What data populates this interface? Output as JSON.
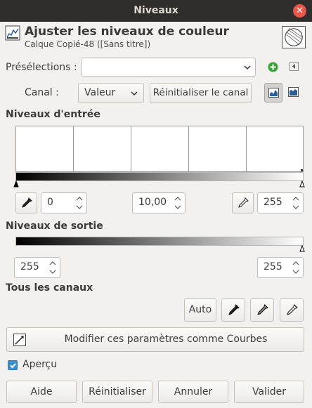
{
  "window": {
    "title": "Niveaux",
    "close_icon": "close-icon"
  },
  "header": {
    "title": "Ajuster les niveaux de couleur",
    "subtitle": "Calque Copié-48 ([Sans titre])"
  },
  "presets": {
    "label": "Présélections :",
    "value": ""
  },
  "channel": {
    "label": "Canal :",
    "value": "Valeur",
    "reset_label": "Réinitialiser le canal"
  },
  "input_levels": {
    "heading": "Niveaux d'entrée",
    "low": "0",
    "gamma": "10,00",
    "high": "255"
  },
  "output_levels": {
    "heading": "Niveaux de sortie",
    "low": "255",
    "high": "255"
  },
  "all_channels": {
    "heading": "Tous les canaux",
    "auto_label": "Auto"
  },
  "curves_button": {
    "label": "Modifier ces paramètres comme Courbes"
  },
  "preview": {
    "label": "Aperçu",
    "checked": true
  },
  "footer": {
    "help": "Aide",
    "reset": "Réinitialiser",
    "cancel": "Annuler",
    "ok": "Valider"
  },
  "colors": {
    "accent": "#3e8ed0",
    "close": "#e9574b",
    "titlebar": "#2f2e2c"
  }
}
